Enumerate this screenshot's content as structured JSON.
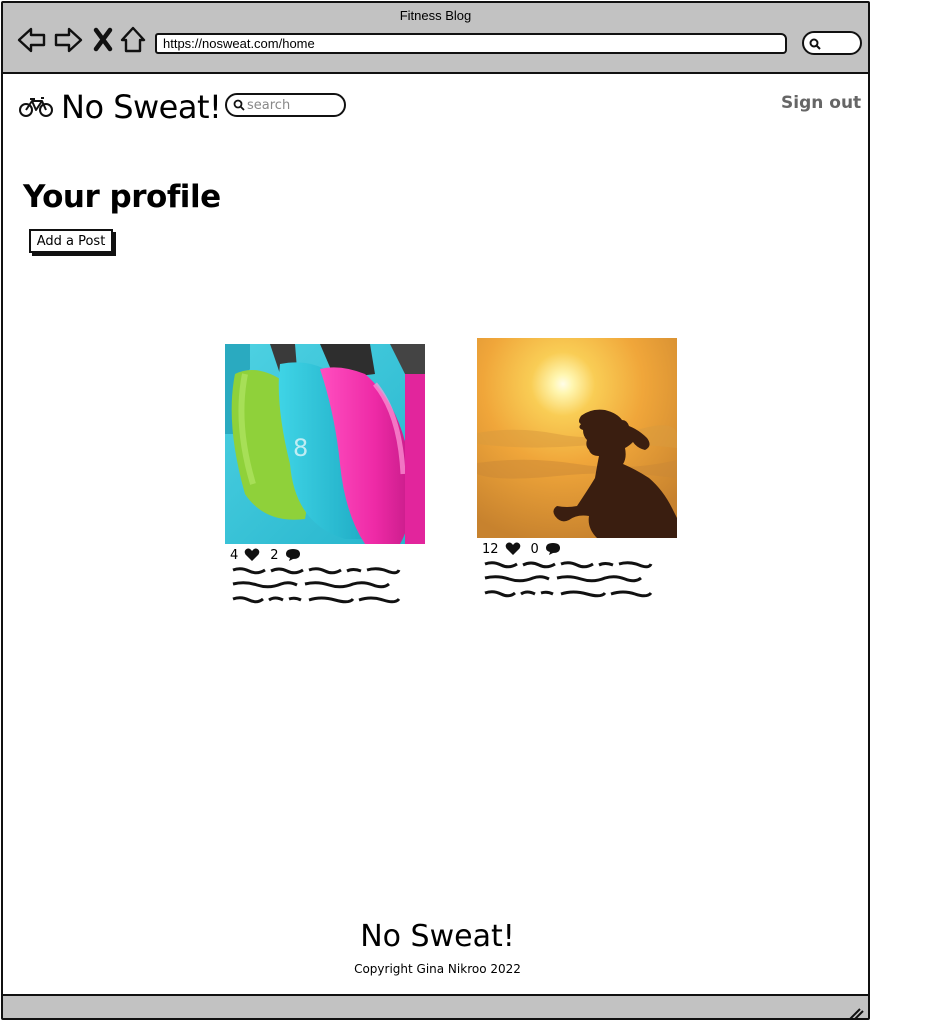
{
  "browser": {
    "window_title": "Fitness Blog",
    "url": "https://nosweat.com/home",
    "nav_icons": [
      "back-arrow-icon",
      "forward-arrow-icon",
      "close-x-icon",
      "home-icon",
      "search-icon"
    ]
  },
  "header": {
    "brand": "No Sweat!",
    "logo_icon": "bicycle-icon",
    "search_placeholder": "search",
    "signout_label": "Sign out"
  },
  "profile": {
    "title": "Your profile",
    "add_post_label": "Add a Post"
  },
  "posts": [
    {
      "image": "kettlebells-photo",
      "likes": "4",
      "comments": "2"
    },
    {
      "image": "runner-sunset-photo",
      "likes": "12",
      "comments": "0"
    }
  ],
  "footer": {
    "brand": "No Sweat!",
    "copyright": "Copyright Gina Nikroo 2022"
  },
  "colors": {
    "chrome": "#c2c2c2",
    "muted_text": "#666666"
  }
}
